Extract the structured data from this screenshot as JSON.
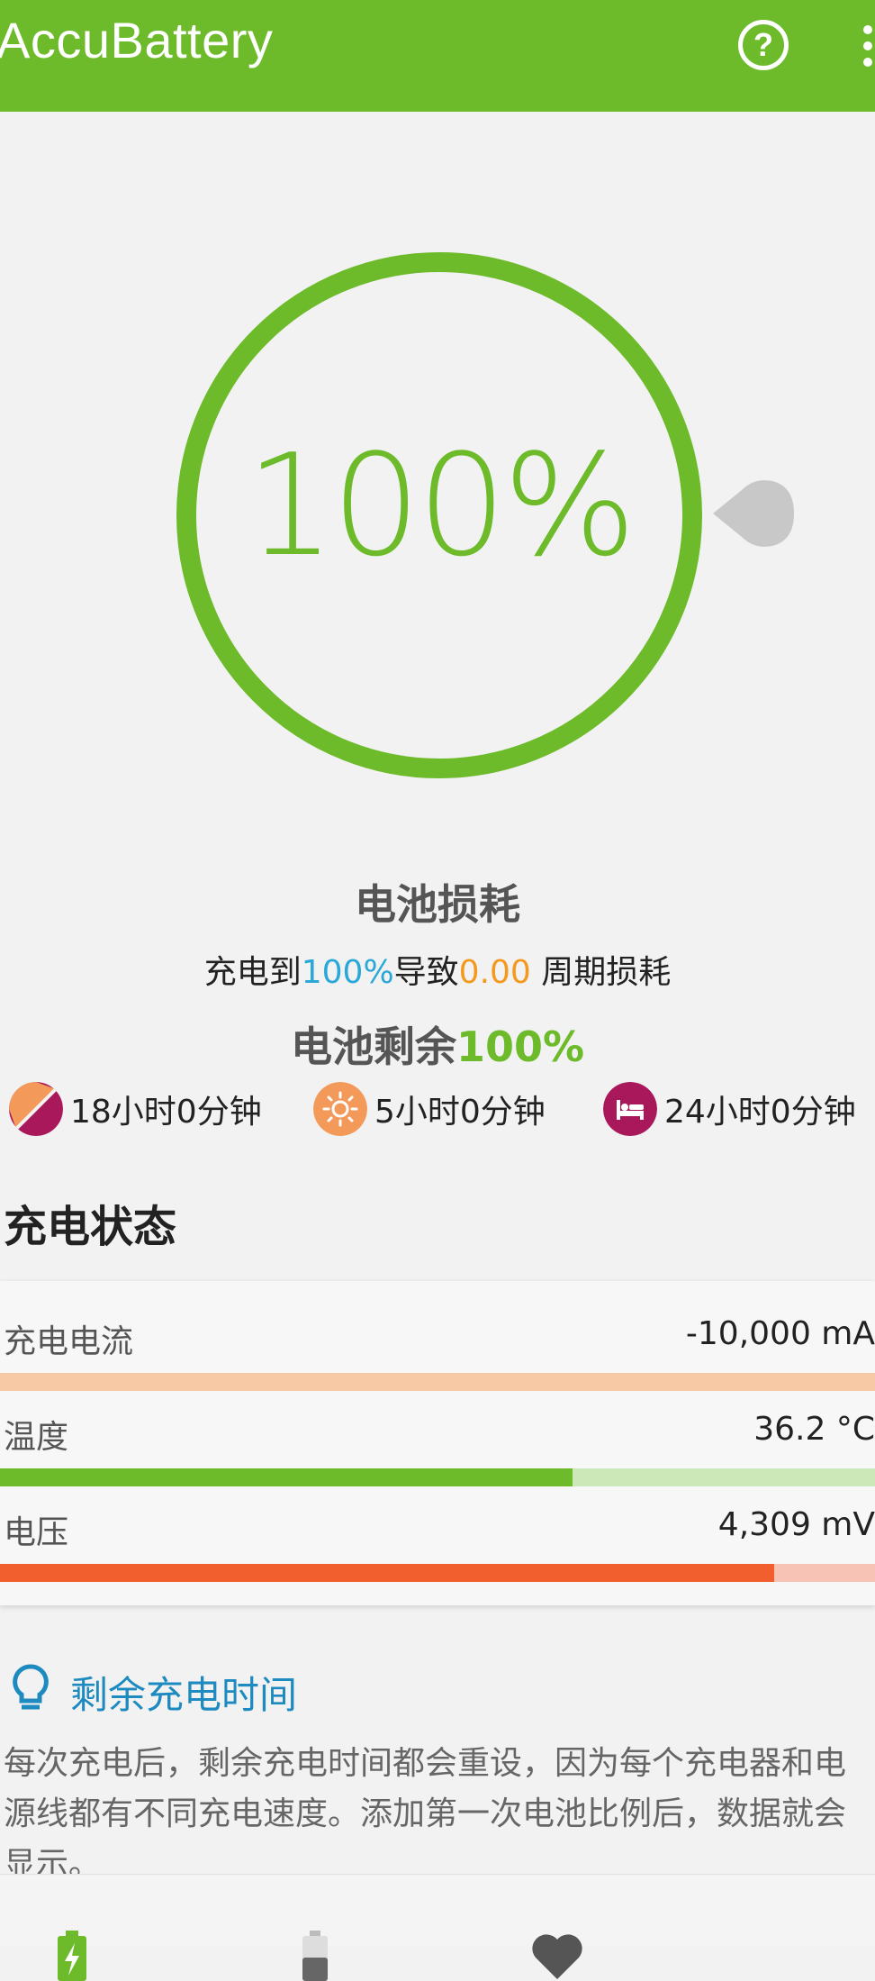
{
  "app_bar": {
    "title": "AccuBattery",
    "help_icon": "help-circle-icon",
    "more_icon": "more-vert-icon",
    "help_glyph": "?"
  },
  "gauge": {
    "value_text": "100%",
    "percent": 100,
    "color": "#6dbb2a"
  },
  "wear": {
    "title": "电池损耗",
    "line_prefix": "充电到",
    "line_percent": "100%",
    "line_middle": "导致",
    "line_cycles": "0.00",
    "line_suffix": " 周期损耗"
  },
  "remaining": {
    "label": "电池剩余",
    "value": "100%"
  },
  "estimates": [
    {
      "icon": "screen-mixed-icon",
      "text": "18小时0分钟"
    },
    {
      "icon": "sun-icon",
      "text": "5小时0分钟"
    },
    {
      "icon": "bed-icon",
      "text": "24小时0分钟"
    }
  ],
  "charging": {
    "title": "充电状态",
    "rows": [
      {
        "label": "充电电流",
        "value": "-10,000 mA",
        "fill": 0.0,
        "track_color": "#f7c9a4",
        "fill_color": "#f39a5a"
      },
      {
        "label": "温度",
        "value": "36.2 °C",
        "fill": 0.654,
        "track_color": "#cde8b8",
        "fill_color": "#6dbb2a"
      },
      {
        "label": "电压",
        "value": "4,309 mV",
        "fill": 0.885,
        "track_color": "#f6c3b4",
        "fill_color": "#f25f2e"
      }
    ]
  },
  "tip": {
    "icon": "lightbulb-icon",
    "title": "剩余充电时间",
    "body": "每次充电后，剩余充电时间都会重设，因为每个充电器和电源线都有不同充电速度。添加第一次电池比例后，数据就会显示。"
  },
  "bottom_nav": [
    {
      "icon": "battery-charging-icon",
      "active": true
    },
    {
      "icon": "battery-icon",
      "active": false
    },
    {
      "icon": "heart-icon",
      "active": false
    }
  ]
}
